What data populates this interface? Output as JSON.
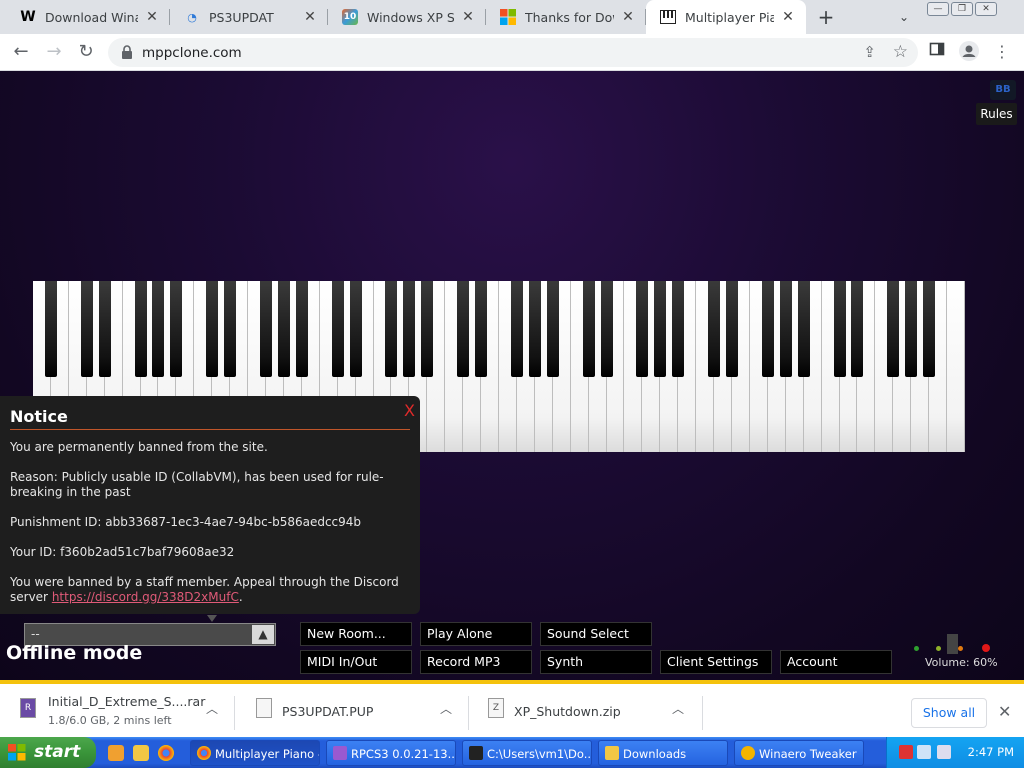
{
  "browser": {
    "tabs": [
      {
        "title": "Download Winaero",
        "icon": "winaero-w-icon",
        "favtext": "W",
        "favcolor": "#000000"
      },
      {
        "title": "PS3UPDAT",
        "icon": "ps3-blue-icon",
        "favtext": "◔",
        "favcolor": "#2f7ad8"
      },
      {
        "title": "Windows XP Shut",
        "icon": "colorful-10-icon",
        "favtext": "10",
        "favcolor": "#e8662a"
      },
      {
        "title": "Thanks for Downl",
        "icon": "microsoft-logo-icon",
        "favtext": "▦",
        "favcolor": "#f25022"
      },
      {
        "title": "Multiplayer Piano",
        "icon": "piano-icon",
        "favtext": "▥",
        "favcolor": "#222222"
      }
    ],
    "new_tab_label": "+",
    "tab_menu_label": "⌄",
    "url": "mppclone.com"
  },
  "page": {
    "rules_icon_label": "BB",
    "rules_label": "Rules",
    "notice": {
      "title": "Notice",
      "close": "X",
      "line1": "You are permanently banned from the site.",
      "line2": "Reason: Publicly usable ID (CollabVM), has been used for rule-breaking in the past",
      "line3": "Punishment ID: abb33687-1ec3-4ae7-94bc-b586aedcc94b",
      "line4": "Your ID: f360b2ad51c7baf79608ae32",
      "line5_prefix": "You were banned by a staff member. Appeal through the Discord server ",
      "line5_link": "https://discord.gg/338D2xMufC",
      "line5_suffix": "."
    },
    "chat_select_value": "--",
    "offline_label": "Offline mode",
    "buttons": {
      "new_room": "New Room...",
      "play_alone": "Play Alone",
      "sound_select": "Sound Select",
      "midi": "MIDI In/Out",
      "record": "Record MP3",
      "synth": "Synth",
      "client_settings": "Client Settings",
      "account": "Account"
    },
    "volume_label": "Volume: 60%",
    "volume": 0.6,
    "status_colors": [
      "#2fa02f",
      "#8fb02a",
      "#e07a10",
      "#e01818"
    ]
  },
  "downloads": {
    "items": [
      {
        "name": "Initial_D_Extreme_S....rar",
        "status": "1.8/6.0 GB, 2 mins left",
        "icon": "winrar-icon",
        "progress": 0.3
      },
      {
        "name": "PS3UPDAT.PUP",
        "status": "",
        "icon": "file-icon"
      },
      {
        "name": "XP_Shutdown.zip",
        "status": "",
        "icon": "zip-icon"
      }
    ],
    "show_all": "Show all",
    "close": "✕"
  },
  "taskbar": {
    "start_label": "start",
    "tasks": [
      {
        "label": "Multiplayer Piano -...",
        "icon": "chrome-icon",
        "color": "#e8453c"
      },
      {
        "label": "RPCS3 0.0.21-13...",
        "icon": "rpcs3-icon",
        "color": "#9b59d0"
      },
      {
        "label": "C:\\Users\\vm1\\Do...",
        "icon": "7zip-icon",
        "color": "#222222"
      },
      {
        "label": "Downloads",
        "icon": "folder-icon",
        "color": "#f2c744"
      },
      {
        "label": "Winaero Tweaker",
        "icon": "winaero-tweaker-icon",
        "color": "#f4b400"
      }
    ],
    "clock": "2:47 PM"
  }
}
